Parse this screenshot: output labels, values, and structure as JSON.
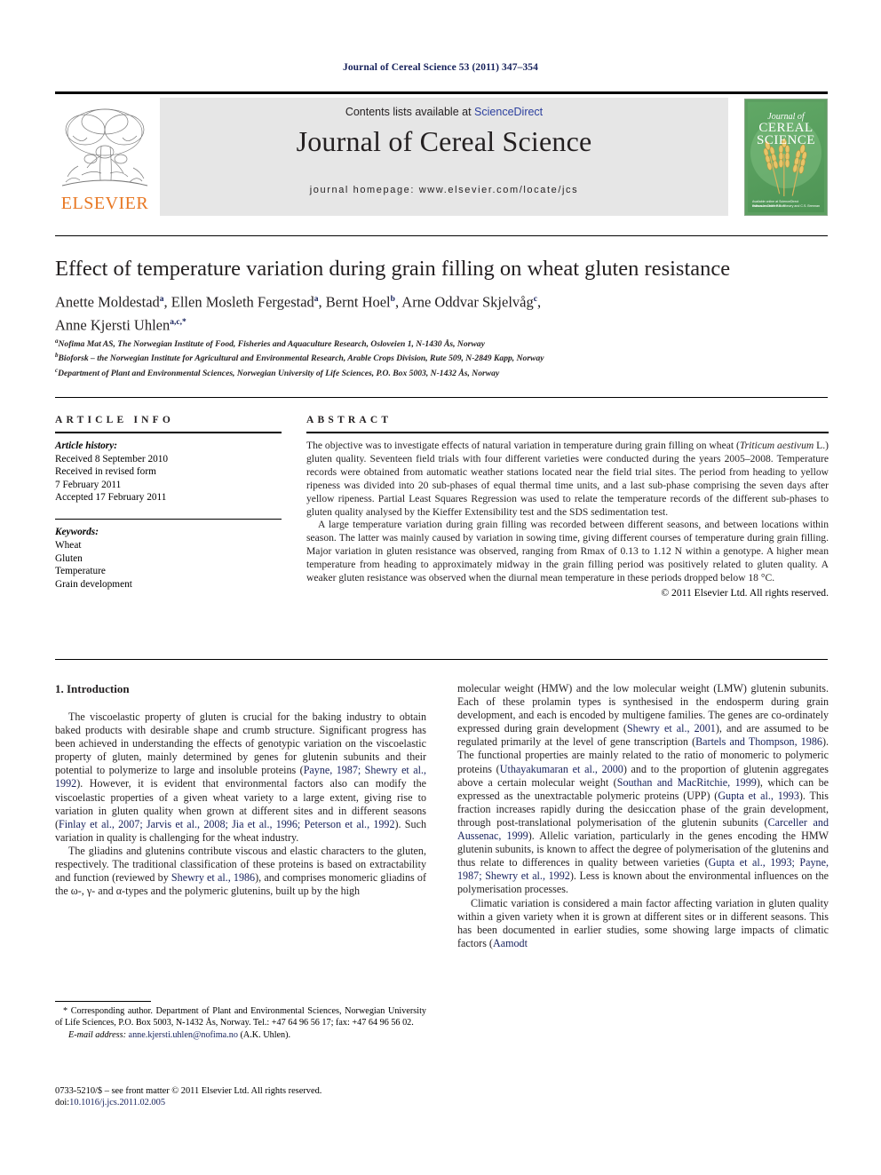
{
  "running_head": "Journal of Cereal Science 53 (2011) 347–354",
  "masthead": {
    "contents_prefix": "Contents lists available at",
    "sciencedirect": "ScienceDirect",
    "journal_title": "Journal of Cereal Science",
    "homepage": "journal homepage: www.elsevier.com/locate/jcs",
    "publisher_logo_text": "ELSEVIER",
    "cover": {
      "line1": "Journal of",
      "line2": "CEREAL",
      "line3": "SCIENCE",
      "bottom_left": "Available online at\nScienceDirect\nwww.sciencedirect.com",
      "bottom_right": "Editors-in-Chief:\nP.R. Shewry\nand C.S. Brennan"
    }
  },
  "article": {
    "title": "Effect of temperature variation during grain filling on wheat gluten resistance",
    "authors_line1": "Anette Moldestad",
    "authors": [
      {
        "name": "Anette Moldestad",
        "sup": "a"
      },
      {
        "name": "Ellen Mosleth Fergestad",
        "sup": "a"
      },
      {
        "name": "Bernt Hoel",
        "sup": "b"
      },
      {
        "name": "Arne Oddvar Skjelvåg",
        "sup": "c"
      },
      {
        "name": "Anne Kjersti Uhlen",
        "sup": "a,c,*"
      }
    ],
    "affiliations": [
      {
        "sup": "a",
        "text": "Nofima Mat AS, The Norwegian Institute of Food, Fisheries and Aquaculture Research, Osloveien 1, N-1430 Ås, Norway"
      },
      {
        "sup": "b",
        "text": "Bioforsk – the Norwegian Institute for Agricultural and Environmental Research, Arable Crops Division, Rute 509, N-2849 Kapp, Norway"
      },
      {
        "sup": "c",
        "text": "Department of Plant and Environmental Sciences, Norwegian University of Life Sciences, P.O. Box 5003, N-1432 Ås, Norway"
      }
    ]
  },
  "article_info": {
    "heading": "ARTICLE INFO",
    "history_label": "Article history:",
    "history_lines": [
      "Received 8 September 2010",
      "Received in revised form",
      "7 February 2011",
      "Accepted 17 February 2011"
    ],
    "keywords_label": "Keywords:",
    "keywords": [
      "Wheat",
      "Gluten",
      "Temperature",
      "Grain development"
    ]
  },
  "abstract": {
    "heading": "ABSTRACT",
    "paragraph1_pre": "The objective was to investigate effects of natural variation in temperature during grain filling on wheat (",
    "paragraph1_italic": "Triticum aestivum",
    "paragraph1_post": " L.) gluten quality. Seventeen field trials with four different varieties were conducted during the years 2005–2008. Temperature records were obtained from automatic weather stations located near the field trial sites. The period from heading to yellow ripeness was divided into 20 sub-phases of equal thermal time units, and a last sub-phase comprising the seven days after yellow ripeness. Partial Least Squares Regression was used to relate the temperature records of the different sub-phases to gluten quality analysed by the Kieffer Extensibility test and the SDS sedimentation test.",
    "paragraph2": "A large temperature variation during grain filling was recorded between different seasons, and between locations within season. The latter was mainly caused by variation in sowing time, giving different courses of temperature during grain filling. Major variation in gluten resistance was observed, ranging from Rmax of 0.13 to 1.12 N within a genotype. A higher mean temperature from heading to approximately midway in the grain filling period was positively related to gluten quality. A weaker gluten resistance was observed when the diurnal mean temperature in these periods dropped below 18 °C.",
    "copyright": "© 2011 Elsevier Ltd. All rights reserved."
  },
  "introduction": {
    "heading": "1. Introduction",
    "left_paragraphs": [
      {
        "parts": [
          {
            "t": "The viscoelastic property of gluten is crucial for the baking industry to obtain baked products with desirable shape and crumb structure. Significant progress has been achieved in understanding the effects of genotypic variation on the viscoelastic property of gluten, mainly determined by genes for glutenin subunits and their potential to polymerize to large and insoluble proteins ("
          },
          {
            "t": "Payne, 1987; Shewry et al., 1992",
            "cite": true
          },
          {
            "t": "). However, it is evident that environmental factors also can modify the viscoelastic properties of a given wheat variety to a large extent, giving rise to variation in gluten quality when grown at different sites and in different seasons ("
          },
          {
            "t": "Finlay et al., 2007; Jarvis et al., 2008; Jia et al., 1996; Peterson et al., 1992",
            "cite": true
          },
          {
            "t": "). Such variation in quality is challenging for the wheat industry."
          }
        ]
      },
      {
        "parts": [
          {
            "t": "The gliadins and glutenins contribute viscous and elastic characters to the gluten, respectively. The traditional classification of these proteins is based on extractability and function (reviewed by "
          },
          {
            "t": "Shewry et al., 1986",
            "cite": true
          },
          {
            "t": "), and comprises monomeric gliadins of the ω-, γ- and α-types and the polymeric glutenins, built up by the high"
          }
        ]
      }
    ],
    "right_paragraphs": [
      {
        "noindent": true,
        "parts": [
          {
            "t": "molecular weight (HMW) and the low molecular weight (LMW) glutenin subunits. Each of these prolamin types is synthesised in the endosperm during grain development, and each is encoded by multigene families. The genes are co-ordinately expressed during grain development ("
          },
          {
            "t": "Shewry et al., 2001",
            "cite": true
          },
          {
            "t": "), and are assumed to be regulated primarily at the level of gene transcription ("
          },
          {
            "t": "Bartels and Thompson, 1986",
            "cite": true
          },
          {
            "t": "). The functional properties are mainly related to the ratio of monomeric to polymeric proteins ("
          },
          {
            "t": "Uthayakumaran et al., 2000",
            "cite": true
          },
          {
            "t": ") and to the proportion of glutenin aggregates above a certain molecular weight ("
          },
          {
            "t": "Southan and MacRitchie, 1999",
            "cite": true
          },
          {
            "t": "), which can be expressed as the unextractable polymeric proteins (UPP) ("
          },
          {
            "t": "Gupta et al., 1993",
            "cite": true
          },
          {
            "t": "). This fraction increases rapidly during the desiccation phase of the grain development, through post-translational polymerisation of the glutenin subunits ("
          },
          {
            "t": "Carceller and Aussenac, 1999",
            "cite": true
          },
          {
            "t": "). Allelic variation, particularly in the genes encoding the HMW glutenin subunits, is known to affect the degree of polymerisation of the glutenins and thus relate to differences in quality between varieties ("
          },
          {
            "t": "Gupta et al., 1993; Payne, 1987; Shewry et al., 1992",
            "cite": true
          },
          {
            "t": "). Less is known about the environmental influences on the polymerisation processes."
          }
        ]
      },
      {
        "parts": [
          {
            "t": "Climatic variation is considered a main factor affecting variation in gluten quality within a given variety when it is grown at different sites or in different seasons. This has been documented in earlier studies, some showing large impacts of climatic factors ("
          },
          {
            "t": "Aamodt",
            "cite": true
          }
        ]
      }
    ]
  },
  "footnotes": {
    "corresponding": "* Corresponding author. Department of Plant and Environmental Sciences, Norwegian University of Life Sciences, P.O. Box 5003, N-1432 Ås, Norway. Tel.: +47 64 96 56 17; fax: +47 64 96 56 02.",
    "email_label": "E-mail address:",
    "email": "anne.kjersti.uhlen@nofima.no",
    "email_suffix": "(A.K. Uhlen).",
    "imprint_line1": "0733-5210/$ – see front matter © 2011 Elsevier Ltd. All rights reserved.",
    "imprint_doi_label": "doi:",
    "imprint_doi": "10.1016/j.jcs.2011.02.005"
  }
}
